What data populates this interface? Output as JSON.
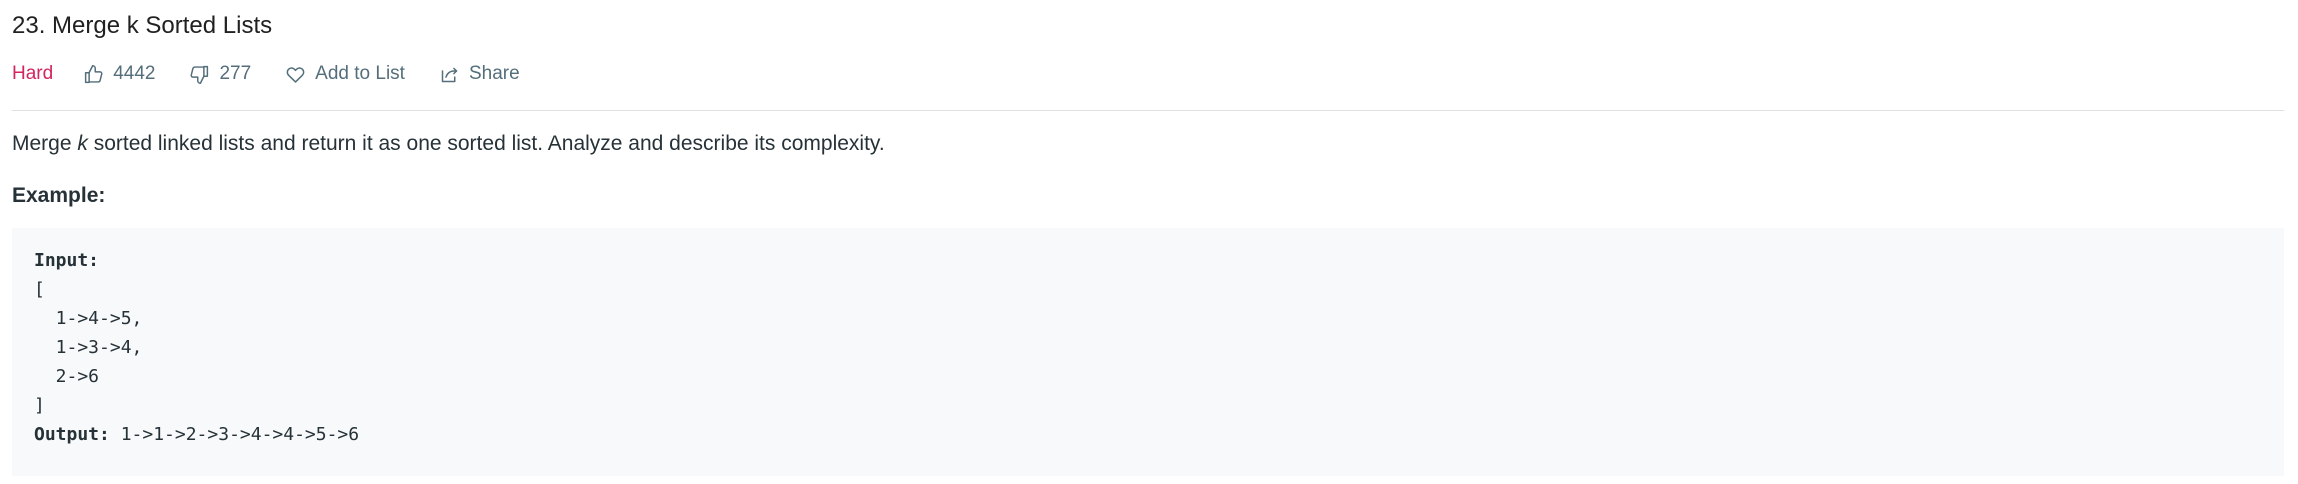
{
  "problem": {
    "title": "23. Merge k Sorted Lists",
    "difficulty": "Hard",
    "likes": "4442",
    "dislikes": "277",
    "add_to_list_label": "Add to List",
    "share_label": "Share",
    "difficulty_color": "#d2245e"
  },
  "description": {
    "before_k": "Merge ",
    "k": "k",
    "after_k": " sorted linked lists and return it as one sorted list. Analyze and describe its complexity."
  },
  "example": {
    "heading": "Example:",
    "input_label": "Input:",
    "input_lines": [
      "[",
      "  1->4->5,",
      "  1->3->4,",
      "  2->6",
      "]"
    ],
    "output_label": "Output:",
    "output_value": " 1->1->2->3->4->4->5->6"
  },
  "icons": {
    "like": "thumbs-up-icon",
    "dislike": "thumbs-down-icon",
    "add": "heart-icon",
    "share": "share-icon"
  }
}
